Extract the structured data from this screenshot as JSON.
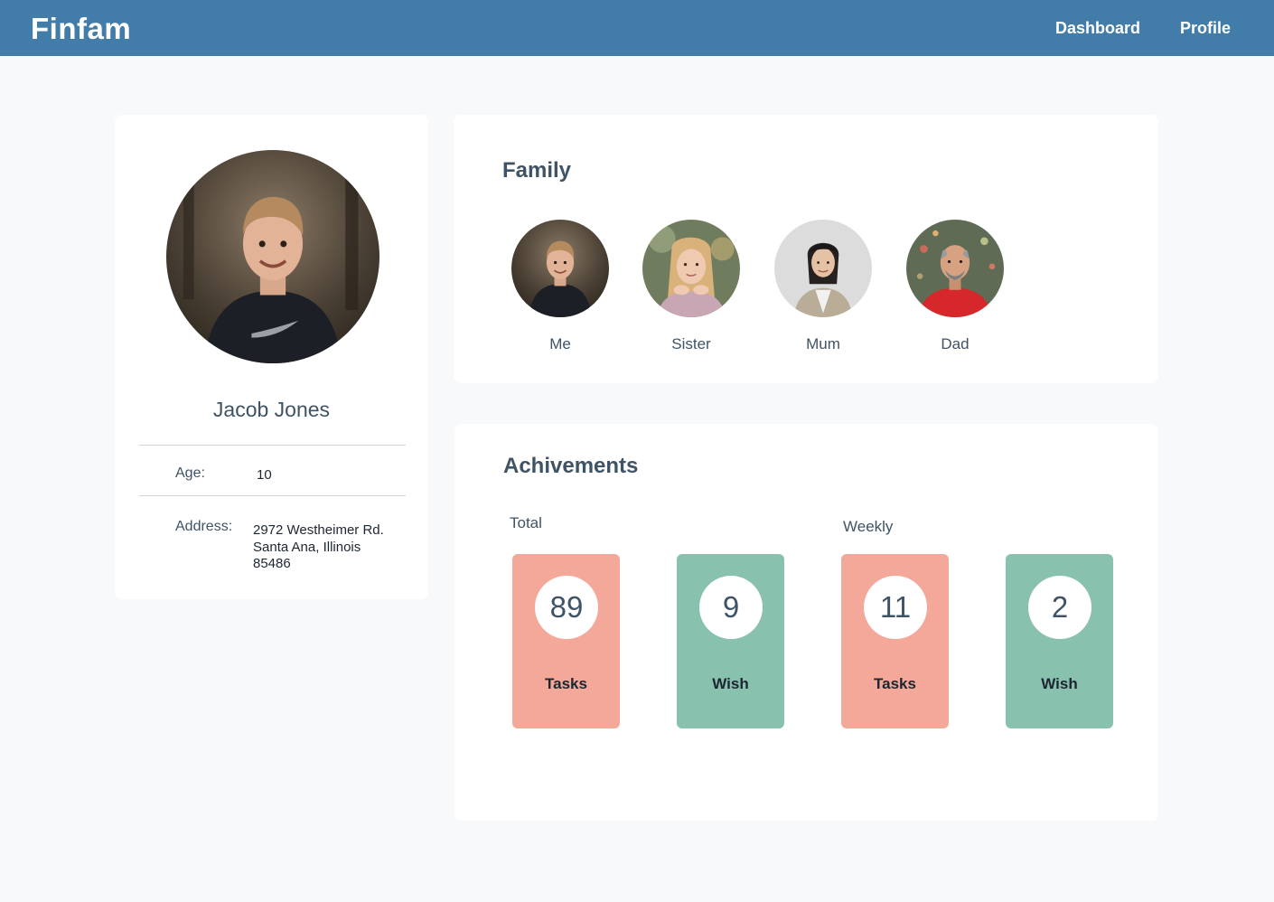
{
  "app": {
    "brand": "Finfam",
    "nav": [
      {
        "label": "Dashboard"
      },
      {
        "label": "Profile"
      }
    ]
  },
  "profile": {
    "name": "Jacob Jones",
    "age_label": "Age:",
    "age_value": "10",
    "address_label": "Address:",
    "address_lines": [
      "2972 Westheimer Rd.",
      "Santa Ana, Illinois",
      "85486"
    ]
  },
  "family": {
    "title": "Family",
    "members": [
      {
        "label": "Me"
      },
      {
        "label": "Sister"
      },
      {
        "label": "Mum"
      },
      {
        "label": "Dad"
      }
    ]
  },
  "achievements": {
    "title": "Achivements",
    "total_label": "Total",
    "weekly_label": "Weekly",
    "stats": [
      {
        "value": "89",
        "caption": "Tasks",
        "color": "#f4a899"
      },
      {
        "value": "9",
        "caption": "Wish",
        "color": "#88c1ae"
      },
      {
        "value": "11",
        "caption": "Tasks",
        "color": "#f4a899"
      },
      {
        "value": "2",
        "caption": "Wish",
        "color": "#88c1ae"
      }
    ]
  },
  "colors": {
    "header": "#427ca8",
    "background": "#f7f9fb",
    "text": "#3f5366"
  }
}
